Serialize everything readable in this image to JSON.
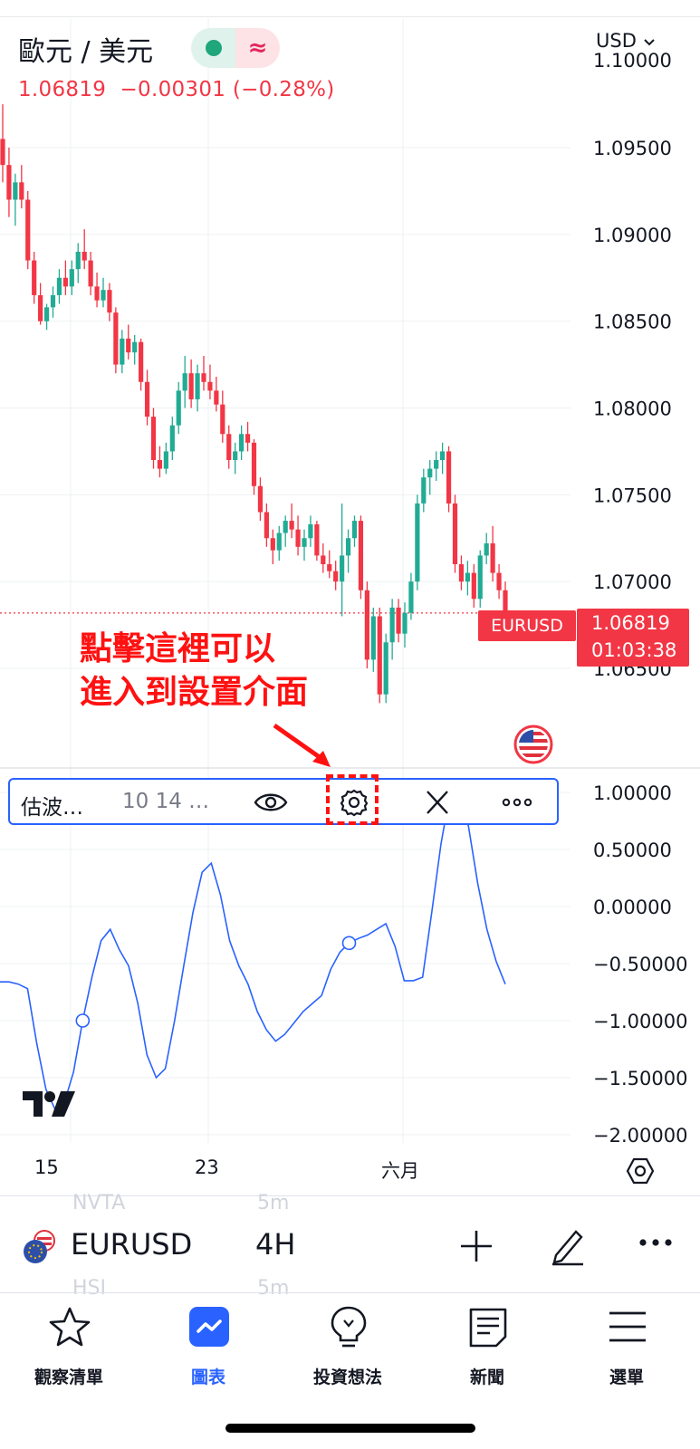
{
  "header": {
    "symbol_title": "歐元 / 美元",
    "status_symbol": "≈",
    "last_price": "1.06819",
    "change": "−0.00301",
    "change_pct": "(−0.28%)",
    "currency": "USD"
  },
  "colors": {
    "up": "#22ab94",
    "down": "#f23645",
    "accent": "#2962ff",
    "annotation": "#ff1111"
  },
  "price_axis": [
    "1.09500",
    "1.09000",
    "1.08500",
    "1.08000",
    "1.07500",
    "1.07000",
    "1.06500"
  ],
  "price_axis_clipped": "1.10000",
  "last_tag": {
    "symbol": "EURUSD",
    "price": "1.06819",
    "countdown": "01:03:38"
  },
  "annotation": {
    "line1": "點擊這裡可以",
    "line2": "進入到設置介面"
  },
  "indicator": {
    "name": "估波…",
    "params": "10 14 …",
    "axis": [
      "1.00000",
      "0.50000",
      "0.00000",
      "−0.50000",
      "−1.00000",
      "−1.50000",
      "−2.00000"
    ],
    "icons": [
      "eye-icon",
      "gear-icon",
      "close-icon",
      "more-icon"
    ]
  },
  "time_axis": [
    "15",
    "23",
    "六月"
  ],
  "ghost_list": {
    "row1_symbol": "NVTA",
    "row1_interval": "5m",
    "row2_symbol": "HSI",
    "row2_interval": "5m"
  },
  "toolbar": {
    "symbol": "EURUSD",
    "interval": "4H"
  },
  "nav": [
    {
      "label": "觀察清單",
      "icon": "star-icon"
    },
    {
      "label": "圖表",
      "icon": "chart-icon"
    },
    {
      "label": "投資想法",
      "icon": "lightbulb-icon"
    },
    {
      "label": "新聞",
      "icon": "news-icon"
    },
    {
      "label": "選單",
      "icon": "menu-icon"
    }
  ],
  "chart_data": [
    {
      "type": "candlestick",
      "symbol": "EURUSD",
      "interval": "4H",
      "y_range": [
        1.06,
        1.1
      ],
      "x_ticks": [
        "15",
        "23",
        "六月"
      ],
      "ohlc": [
        [
          1.0955,
          1.0975,
          1.093,
          1.094
        ],
        [
          1.094,
          1.095,
          1.091,
          1.092
        ],
        [
          1.092,
          1.0935,
          1.0905,
          1.093
        ],
        [
          1.093,
          1.094,
          1.0915,
          1.092
        ],
        [
          1.092,
          1.0925,
          1.088,
          1.0885
        ],
        [
          1.0885,
          1.089,
          1.086,
          1.0865
        ],
        [
          1.0865,
          1.0872,
          1.0848,
          1.085
        ],
        [
          1.085,
          1.086,
          1.0845,
          1.0858
        ],
        [
          1.0858,
          1.087,
          1.0852,
          1.0865
        ],
        [
          1.0865,
          1.088,
          1.086,
          1.0875
        ],
        [
          1.0875,
          1.0885,
          1.0865,
          1.087
        ],
        [
          1.087,
          1.0885,
          1.0865,
          1.088
        ],
        [
          1.088,
          1.0895,
          1.0872,
          1.089
        ],
        [
          1.089,
          1.0903,
          1.088,
          1.0885
        ],
        [
          1.0885,
          1.089,
          1.0865,
          1.087
        ],
        [
          1.087,
          1.0878,
          1.0858,
          1.0862
        ],
        [
          1.0862,
          1.0875,
          1.0858,
          1.0868
        ],
        [
          1.0868,
          1.0872,
          1.085,
          1.0855
        ],
        [
          1.0855,
          1.0858,
          1.082,
          1.0825
        ],
        [
          1.0825,
          1.0845,
          1.082,
          1.084
        ],
        [
          1.084,
          1.0848,
          1.0828,
          1.0832
        ],
        [
          1.0832,
          1.0842,
          1.0825,
          1.0838
        ],
        [
          1.0838,
          1.084,
          1.081,
          1.0815
        ],
        [
          1.0815,
          1.0822,
          1.079,
          1.0795
        ],
        [
          1.0795,
          1.08,
          1.0765,
          1.077
        ],
        [
          1.077,
          1.0778,
          1.076,
          1.0765
        ],
        [
          1.0765,
          1.078,
          1.0762,
          1.0775
        ],
        [
          1.0775,
          1.0795,
          1.077,
          1.079
        ],
        [
          1.079,
          1.0815,
          1.0785,
          1.081
        ],
        [
          1.081,
          1.083,
          1.08,
          1.082
        ],
        [
          1.082,
          1.0828,
          1.08,
          1.0805
        ],
        [
          1.0805,
          1.0825,
          1.0798,
          1.082
        ],
        [
          1.082,
          1.083,
          1.081,
          1.0815
        ],
        [
          1.0815,
          1.0825,
          1.0805,
          1.081
        ],
        [
          1.081,
          1.0818,
          1.0798,
          1.0802
        ],
        [
          1.0802,
          1.081,
          1.078,
          1.0785
        ],
        [
          1.0785,
          1.079,
          1.0765,
          1.077
        ],
        [
          1.077,
          1.078,
          1.0762,
          1.0775
        ],
        [
          1.0775,
          1.079,
          1.077,
          1.0785
        ],
        [
          1.0785,
          1.0792,
          1.0775,
          1.078
        ],
        [
          1.078,
          1.0782,
          1.075,
          1.0755
        ],
        [
          1.0755,
          1.076,
          1.0735,
          1.074
        ],
        [
          1.074,
          1.0745,
          1.072,
          1.0725
        ],
        [
          1.0725,
          1.073,
          1.071,
          1.0718
        ],
        [
          1.0718,
          1.0732,
          1.0712,
          1.0728
        ],
        [
          1.0728,
          1.0738,
          1.072,
          1.0735
        ],
        [
          1.0735,
          1.0745,
          1.0725,
          1.073
        ],
        [
          1.073,
          1.0738,
          1.0715,
          1.072
        ],
        [
          1.072,
          1.073,
          1.0712,
          1.0725
        ],
        [
          1.0725,
          1.0738,
          1.072,
          1.0733
        ],
        [
          1.0733,
          1.0735,
          1.0712,
          1.0715
        ],
        [
          1.0715,
          1.0722,
          1.0705,
          1.071
        ],
        [
          1.071,
          1.0718,
          1.0702,
          1.0706
        ],
        [
          1.0706,
          1.0712,
          1.0695,
          1.07
        ],
        [
          1.07,
          1.0745,
          1.068,
          1.0715
        ],
        [
          1.0715,
          1.073,
          1.0705,
          1.0725
        ],
        [
          1.0725,
          1.0738,
          1.072,
          1.0735
        ],
        [
          1.0735,
          1.0738,
          1.069,
          1.0695
        ],
        [
          1.0695,
          1.07,
          1.065,
          1.0655
        ],
        [
          1.0655,
          1.0685,
          1.0648,
          1.068
        ],
        [
          1.068,
          1.0685,
          1.063,
          1.0635
        ],
        [
          1.0635,
          1.067,
          1.063,
          1.0665
        ],
        [
          1.0665,
          1.069,
          1.0655,
          1.0685
        ],
        [
          1.0685,
          1.069,
          1.0665,
          1.067
        ],
        [
          1.067,
          1.0688,
          1.0662,
          1.0682
        ],
        [
          1.0682,
          1.0705,
          1.0678,
          1.07
        ],
        [
          1.07,
          1.075,
          1.0695,
          1.0745
        ],
        [
          1.0745,
          1.0765,
          1.074,
          1.076
        ],
        [
          1.076,
          1.077,
          1.075,
          1.0765
        ],
        [
          1.0765,
          1.0775,
          1.0758,
          1.077
        ],
        [
          1.077,
          1.078,
          1.0762,
          1.0775
        ],
        [
          1.0775,
          1.0778,
          1.074,
          1.0745
        ],
        [
          1.0745,
          1.075,
          1.0705,
          1.071
        ],
        [
          1.071,
          1.0715,
          1.0695,
          1.07
        ],
        [
          1.07,
          1.0712,
          1.0692,
          1.0705
        ],
        [
          1.0705,
          1.071,
          1.0685,
          1.069
        ],
        [
          1.069,
          1.0718,
          1.0685,
          1.0715
        ],
        [
          1.0715,
          1.0728,
          1.071,
          1.0722
        ],
        [
          1.0722,
          1.0732,
          1.07,
          1.0705
        ],
        [
          1.0705,
          1.071,
          1.069,
          1.0695
        ],
        [
          1.0695,
          1.07,
          1.068,
          1.0682
        ]
      ]
    },
    {
      "type": "line",
      "name": "估波…",
      "y_range": [
        -2.0,
        1.0
      ],
      "values": [
        -0.66,
        -0.66,
        -0.68,
        -0.72,
        -1.2,
        -1.6,
        -1.78,
        -1.72,
        -1.45,
        -1.0,
        -0.62,
        -0.3,
        -0.2,
        -0.38,
        -0.52,
        -0.85,
        -1.3,
        -1.5,
        -1.42,
        -1.0,
        -0.52,
        -0.05,
        0.3,
        0.38,
        0.1,
        -0.3,
        -0.52,
        -0.68,
        -0.92,
        -1.08,
        -1.18,
        -1.12,
        -1.02,
        -0.92,
        -0.85,
        -0.78,
        -0.55,
        -0.4,
        -0.32,
        -0.28,
        -0.25,
        -0.2,
        -0.15,
        -0.35,
        -0.65,
        -0.65,
        -0.62,
        -0.05,
        0.55,
        1.0,
        1.02,
        0.7,
        0.2,
        -0.2,
        -0.48,
        -0.68
      ],
      "markers": [
        9,
        38
      ]
    }
  ]
}
